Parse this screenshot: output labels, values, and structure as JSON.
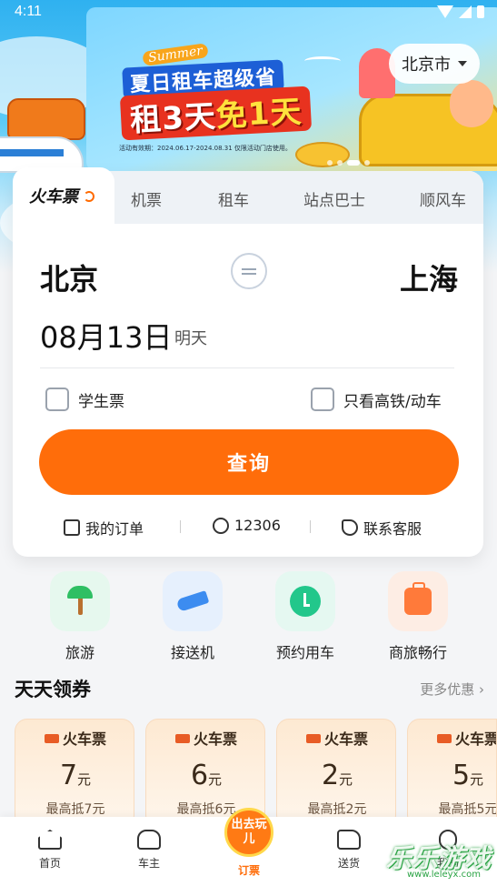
{
  "status_bar": {
    "time": "4:11"
  },
  "banner": {
    "tag": "Summer",
    "headline": "夏日租车超级省",
    "big_prefix": "租3天",
    "big_accent": "免1天",
    "period": "活动有效期：2024.06.17-2024.08.31  仅限活动门店使用。",
    "city": "北京市"
  },
  "tabs": [
    {
      "label": "火车票",
      "active": true
    },
    {
      "label": "机票"
    },
    {
      "label": "租车"
    },
    {
      "label": "站点巴士"
    },
    {
      "label": "顺风车"
    }
  ],
  "trip": {
    "from": "北京",
    "to": "上海",
    "date": "08月13日",
    "date_hint": "明天"
  },
  "options": {
    "student": "学生票",
    "high_speed_only": "只看高铁/动车"
  },
  "search_button": "查询",
  "quick_links": {
    "orders": "我的订单",
    "hotline": "12306",
    "service": "联系客服"
  },
  "services": [
    {
      "label": "旅游",
      "icon": "palm-tree-icon",
      "bg": "#e6f8ee"
    },
    {
      "label": "接送机",
      "icon": "airplane-icon",
      "bg": "#e6f0fd"
    },
    {
      "label": "预约用车",
      "icon": "clock-icon",
      "bg": "#e5f8f1"
    },
    {
      "label": "商旅畅行",
      "icon": "luggage-icon",
      "bg": "#fdede4"
    }
  ],
  "coupons_section": {
    "title": "天天领券",
    "more": "更多优惠 ›",
    "items": [
      {
        "title": "火车票",
        "amount": "7",
        "unit": "元",
        "cap": "最高抵7元"
      },
      {
        "title": "火车票",
        "amount": "6",
        "unit": "元",
        "cap": "最高抵6元"
      },
      {
        "title": "火车票",
        "amount": "2",
        "unit": "元",
        "cap": "最高抵2元"
      },
      {
        "title": "火车票",
        "amount": "5",
        "unit": "元",
        "cap": "最高抵5元"
      }
    ]
  },
  "bottom_nav": {
    "home": "首页",
    "car_owner": "车主",
    "center_badge": "出去玩儿",
    "tickets": "订票",
    "delivery": "送货",
    "me": "我的"
  },
  "watermark": {
    "text": "乐乐游戏",
    "url": "www.leleyx.com"
  },
  "colors": {
    "accent": "#ff6d0a",
    "sky": "#2fb1f0"
  }
}
